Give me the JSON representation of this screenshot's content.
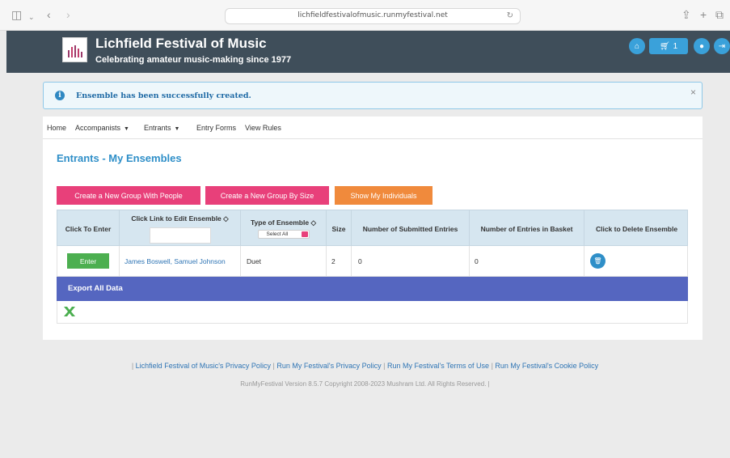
{
  "browser": {
    "url": "lichfieldfestivalofmusic.runmyfestival.net"
  },
  "header": {
    "title": "Lichfield Festival of Music",
    "tagline": "Celebrating amateur music-making since 1977",
    "basket_count": "1"
  },
  "alert": {
    "message": "Ensemble has been successfully created.",
    "close": "×"
  },
  "nav": {
    "home": "Home",
    "accompanists": "Accompanists",
    "entrants": "Entrants",
    "entry_forms": "Entry Forms",
    "view_rules": "View Rules"
  },
  "page": {
    "title": "Entrants - My Ensembles"
  },
  "buttons": {
    "create_with_people": "Create a New Group With People",
    "create_by_size": "Create a New Group By Size",
    "show_individuals": "Show My Individuals"
  },
  "table": {
    "headers": {
      "click_to_enter": "Click To Enter",
      "edit_ensemble": "Click Link to Edit Ensemble ◇",
      "type_of_ensemble": "Type of Ensemble ◇",
      "type_filter": "Select All",
      "size": "Size",
      "submitted_entries": "Number of Submitted Entries",
      "entries_in_basket": "Number of Entries in Basket",
      "delete_ensemble": "Click to Delete Ensemble"
    },
    "rows": [
      {
        "enter": "Enter",
        "ensemble": "James Boswell, Samuel Johnson",
        "type": "Duet",
        "size": "2",
        "submitted": "0",
        "in_basket": "0"
      }
    ],
    "export_label": "Export All Data"
  },
  "footer": {
    "links": [
      "Lichfield Festival of Music's Privacy Policy",
      "Run My Festival's Privacy Policy",
      "Run My Festival's Terms of Use",
      "Run My Festival's Cookie Policy"
    ],
    "separator": "|",
    "copyright": "RunMyFestival Version 8.5.7 Copyright 2008-2023 Mushram Ltd. All Rights Reserved. |"
  },
  "colors": {
    "header_bg": "#3f4e5a",
    "accent_blue": "#2f8fc8",
    "pink": "#e8407a",
    "orange": "#f08a3c",
    "green": "#4caf50",
    "export_bar": "#5566c0"
  }
}
